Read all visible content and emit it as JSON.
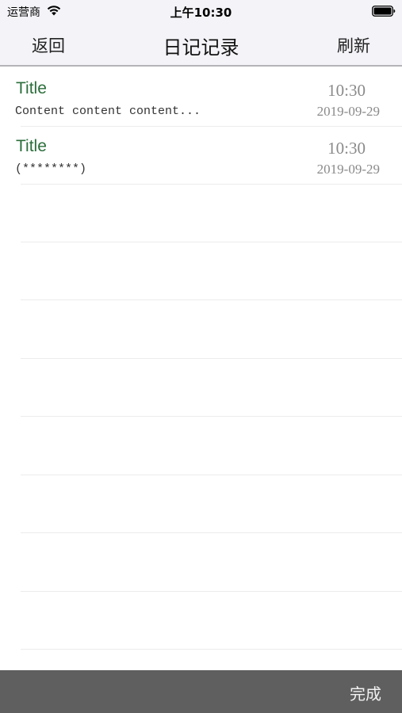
{
  "status_bar": {
    "carrier": "运营商",
    "time": "上午10:30"
  },
  "nav": {
    "back_label": "返回",
    "title": "日记记录",
    "refresh_label": "刷新"
  },
  "entries": [
    {
      "title": "Title",
      "content": "Content content content...",
      "time": "10:30",
      "date": "2019-09-29"
    },
    {
      "title": "Title",
      "content": "(********)",
      "time": "10:30",
      "date": "2019-09-29"
    }
  ],
  "toolbar": {
    "done_label": "完成"
  },
  "colors": {
    "title_green": "#2b6e3b",
    "bar_background": "#f4f3f8",
    "bottom_bar": "#5f5f5f"
  }
}
